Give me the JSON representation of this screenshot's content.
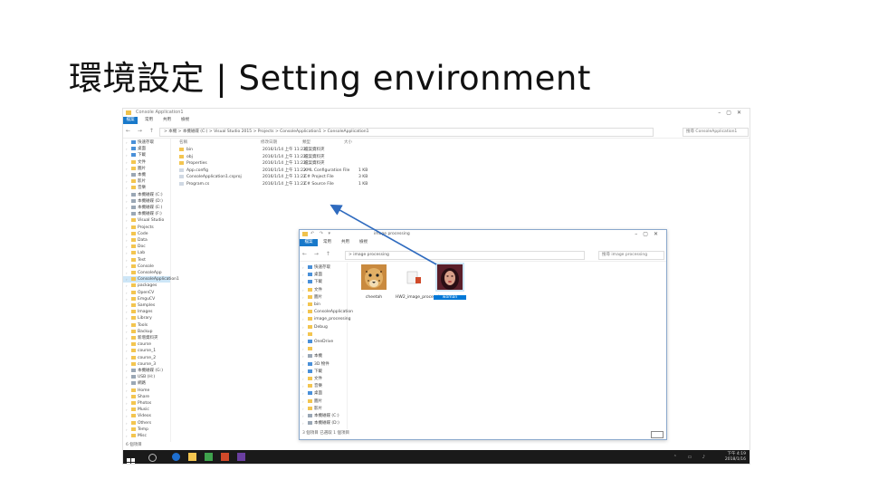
{
  "slide": {
    "title": "環境設定 | Setting environment"
  },
  "explorer": {
    "window_title": "Console Application1",
    "ribbon_tabs": [
      "檔案",
      "常用",
      "共用",
      "檢視"
    ],
    "nav_buttons": "← → ↑",
    "address_path": "> 本機 > 本機磁碟 (C:) > Visual Studio 2015 > Projects > ConsoleApplication1 > ConsoleApplication1",
    "search_placeholder": "搜尋 ConsoleApplication1",
    "columns": [
      "名稱",
      "修改日期",
      "類型",
      "大小"
    ],
    "files": [
      {
        "name": "bin",
        "date": "2016/1/14 上午 11:22",
        "type": "檔案資料夾",
        "size": ""
      },
      {
        "name": "obj",
        "date": "2016/1/14 上午 11:22",
        "type": "檔案資料夾",
        "size": ""
      },
      {
        "name": "Properties",
        "date": "2016/1/14 上午 11:22",
        "type": "檔案資料夾",
        "size": ""
      },
      {
        "name": "App.config",
        "date": "2016/1/14 上午 11:22",
        "type": "XML Configuration File",
        "size": "1 KB"
      },
      {
        "name": "ConsoleApplication1.csproj",
        "date": "2016/1/14 上午 11:22",
        "type": "C# Project File",
        "size": "3 KB"
      },
      {
        "name": "Program.cs",
        "date": "2016/1/14 上午 11:22",
        "type": "C# Source File",
        "size": "1 KB"
      }
    ],
    "tree": [
      {
        "label": "快速存取",
        "icon": "blue"
      },
      {
        "label": "桌面",
        "icon": "blue"
      },
      {
        "label": "下載",
        "icon": "blue"
      },
      {
        "label": "文件",
        "icon": ""
      },
      {
        "label": "圖片",
        "icon": ""
      },
      {
        "label": "本機",
        "icon": "drive"
      },
      {
        "label": "影片",
        "icon": ""
      },
      {
        "label": "音樂",
        "icon": ""
      },
      {
        "label": "本機磁碟 (C:)",
        "icon": "drive"
      },
      {
        "label": "本機磁碟 (D:)",
        "icon": "drive"
      },
      {
        "label": "本機磁碟 (E:)",
        "icon": "drive"
      },
      {
        "label": "本機磁碟 (F:)",
        "icon": "drive"
      },
      {
        "label": "Visual Studio",
        "icon": ""
      },
      {
        "label": "Projects",
        "icon": ""
      },
      {
        "label": "Code",
        "icon": ""
      },
      {
        "label": "Data",
        "icon": ""
      },
      {
        "label": "Doc",
        "icon": ""
      },
      {
        "label": "Lab",
        "icon": ""
      },
      {
        "label": "Test",
        "icon": ""
      },
      {
        "label": "Console",
        "icon": ""
      },
      {
        "label": "ConsoleApp",
        "icon": ""
      },
      {
        "label": "ConsoleApplication1",
        "icon": ""
      },
      {
        "label": "packages",
        "icon": ""
      },
      {
        "label": "OpenCV",
        "icon": ""
      },
      {
        "label": "EmguCV",
        "icon": ""
      },
      {
        "label": "Samples",
        "icon": ""
      },
      {
        "label": "Images",
        "icon": ""
      },
      {
        "label": "Library",
        "icon": ""
      },
      {
        "label": "Tools",
        "icon": ""
      },
      {
        "label": "Backup",
        "icon": ""
      },
      {
        "label": "新增資料夾",
        "icon": ""
      },
      {
        "label": "course",
        "icon": ""
      },
      {
        "label": "course_1",
        "icon": ""
      },
      {
        "label": "course_2",
        "icon": ""
      },
      {
        "label": "course_3",
        "icon": ""
      },
      {
        "label": "本機磁碟 (G:)",
        "icon": "drive"
      },
      {
        "label": "USB (H:)",
        "icon": "drive"
      },
      {
        "label": "網路",
        "icon": "drive"
      },
      {
        "label": "Home",
        "icon": ""
      },
      {
        "label": "Share",
        "icon": ""
      },
      {
        "label": "Photos",
        "icon": ""
      },
      {
        "label": "Music",
        "icon": ""
      },
      {
        "label": "Videos",
        "icon": ""
      },
      {
        "label": "Others",
        "icon": ""
      },
      {
        "label": "Temp",
        "icon": ""
      },
      {
        "label": "Misc",
        "icon": ""
      }
    ],
    "selected_tree_index": 21,
    "status": "6 個項目"
  },
  "image_window": {
    "title": "image processing",
    "tools": "↶ ↷ ▾",
    "ribbon_tabs": [
      "檔案",
      "常用",
      "共用",
      "檢視"
    ],
    "nav_buttons": "← → ↑",
    "address_path": "> image processing",
    "search_placeholder": "搜尋 image processing",
    "tree": [
      {
        "label": "快速存取",
        "icon": "blue"
      },
      {
        "label": "桌面",
        "icon": "blue"
      },
      {
        "label": "下載",
        "icon": "blue"
      },
      {
        "label": "文件",
        "icon": ""
      },
      {
        "label": "圖片",
        "icon": ""
      },
      {
        "label": "bin",
        "icon": ""
      },
      {
        "label": "ConsoleApplication",
        "icon": ""
      },
      {
        "label": "image_processing",
        "icon": ""
      },
      {
        "label": "Debug",
        "icon": ""
      },
      {
        "label": "",
        "icon": ""
      },
      {
        "label": "OneDrive",
        "icon": "blue"
      },
      {
        "label": "",
        "icon": ""
      },
      {
        "label": "本機",
        "icon": "drive"
      },
      {
        "label": "3D 物件",
        "icon": "blue"
      },
      {
        "label": "下載",
        "icon": "blue"
      },
      {
        "label": "文件",
        "icon": ""
      },
      {
        "label": "音樂",
        "icon": ""
      },
      {
        "label": "桌面",
        "icon": "blue"
      },
      {
        "label": "圖片",
        "icon": ""
      },
      {
        "label": "影片",
        "icon": ""
      },
      {
        "label": "本機磁碟 (C:)",
        "icon": "drive"
      },
      {
        "label": "本機磁碟 (D:)",
        "icon": "drive"
      }
    ],
    "selected_tree_index": 0,
    "thumbnails": [
      {
        "caption": "cheetah",
        "kind": "cheetah"
      },
      {
        "caption": "HW2_image_processing",
        "kind": "file"
      },
      {
        "caption": "woman",
        "kind": "woman"
      }
    ],
    "selected_thumb_index": 2,
    "status": "3 個項目  已選取 1 個項目"
  },
  "taskbar": {
    "clock_time": "下午 4:19",
    "clock_date": "2018/1/16",
    "tray": "⌃ ▭ ♪"
  },
  "colors": {
    "accent": "#1979ca",
    "selection": "#cde6f7",
    "arrow": "#2f6bbf",
    "taskbar": "#1a1a1a"
  }
}
